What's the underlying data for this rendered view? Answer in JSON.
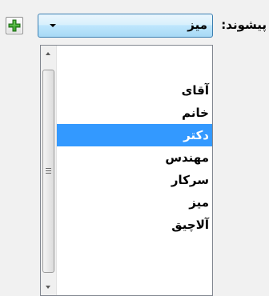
{
  "form": {
    "prefix_label": "پیشوند:",
    "selected_value": "میز"
  },
  "dropdown": {
    "items": [
      "آقای",
      "خانم",
      "دکتر",
      "مهندس",
      "سرکار",
      "میز",
      "آلاچیق"
    ],
    "highlighted": "دکتر"
  },
  "icons": {
    "add": "plus-icon",
    "combo_arrow": "chevron-down-icon",
    "scroll_up": "scroll-up-arrow-icon",
    "scroll_down": "scroll-down-arrow-icon"
  },
  "colors": {
    "highlight": "#3399ff",
    "plus_green": "#3aa02b"
  }
}
